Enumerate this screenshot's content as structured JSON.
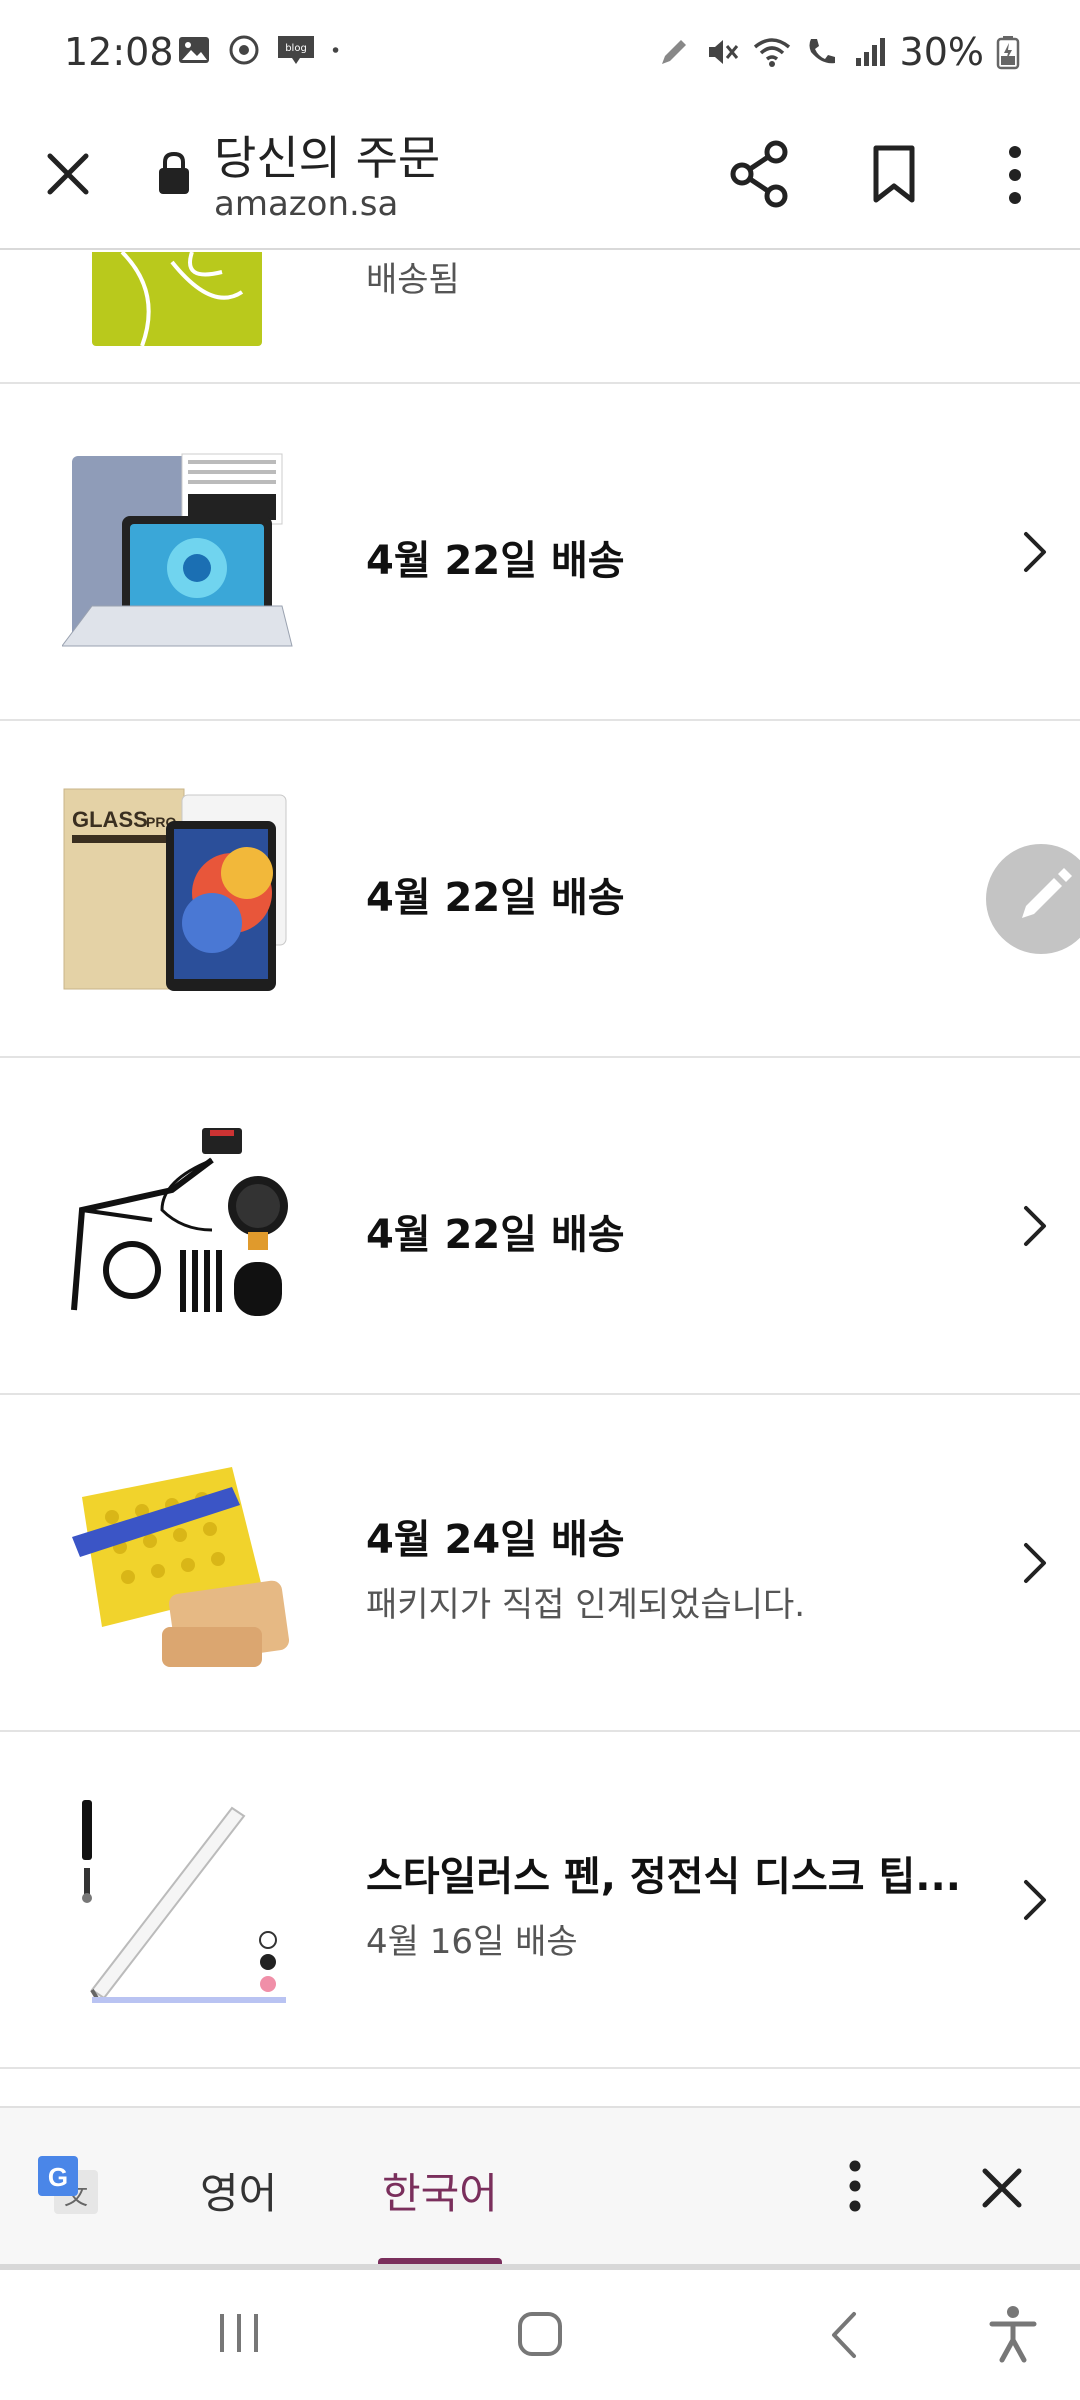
{
  "status_bar": {
    "time": "12:08",
    "battery": "30%",
    "left_icons": [
      "gallery-icon",
      "sync-icon",
      "blog-icon",
      "dot-icon"
    ],
    "right_icons": [
      "pen-icon",
      "mute-icon",
      "wifi-icon",
      "wifi-call-icon",
      "signal-icon",
      "battery-icon"
    ]
  },
  "browser": {
    "title": "당신의 주문",
    "url": "amazon.sa"
  },
  "orders": {
    "partial_item": {
      "status": "배송됨"
    },
    "items": [
      {
        "title": "4월 22일 배송",
        "subtitle": ""
      },
      {
        "title": "4월 22일 배송",
        "subtitle": ""
      },
      {
        "title": "4월 22일 배송",
        "subtitle": ""
      },
      {
        "title": "4월 24일 배송",
        "subtitle": "패키지가 직접 인계되었습니다."
      },
      {
        "title": "스타일러스 펜, 정전식 디스크 팁...",
        "subtitle": "4월 16일 배송"
      }
    ]
  },
  "translate_bar": {
    "source_lang": "영어",
    "target_lang": "한국어",
    "active_color": "#7a2f5c"
  },
  "colors": {
    "divider": "#e3e3e3",
    "text_primary": "#111111",
    "text_secondary": "#555555"
  }
}
